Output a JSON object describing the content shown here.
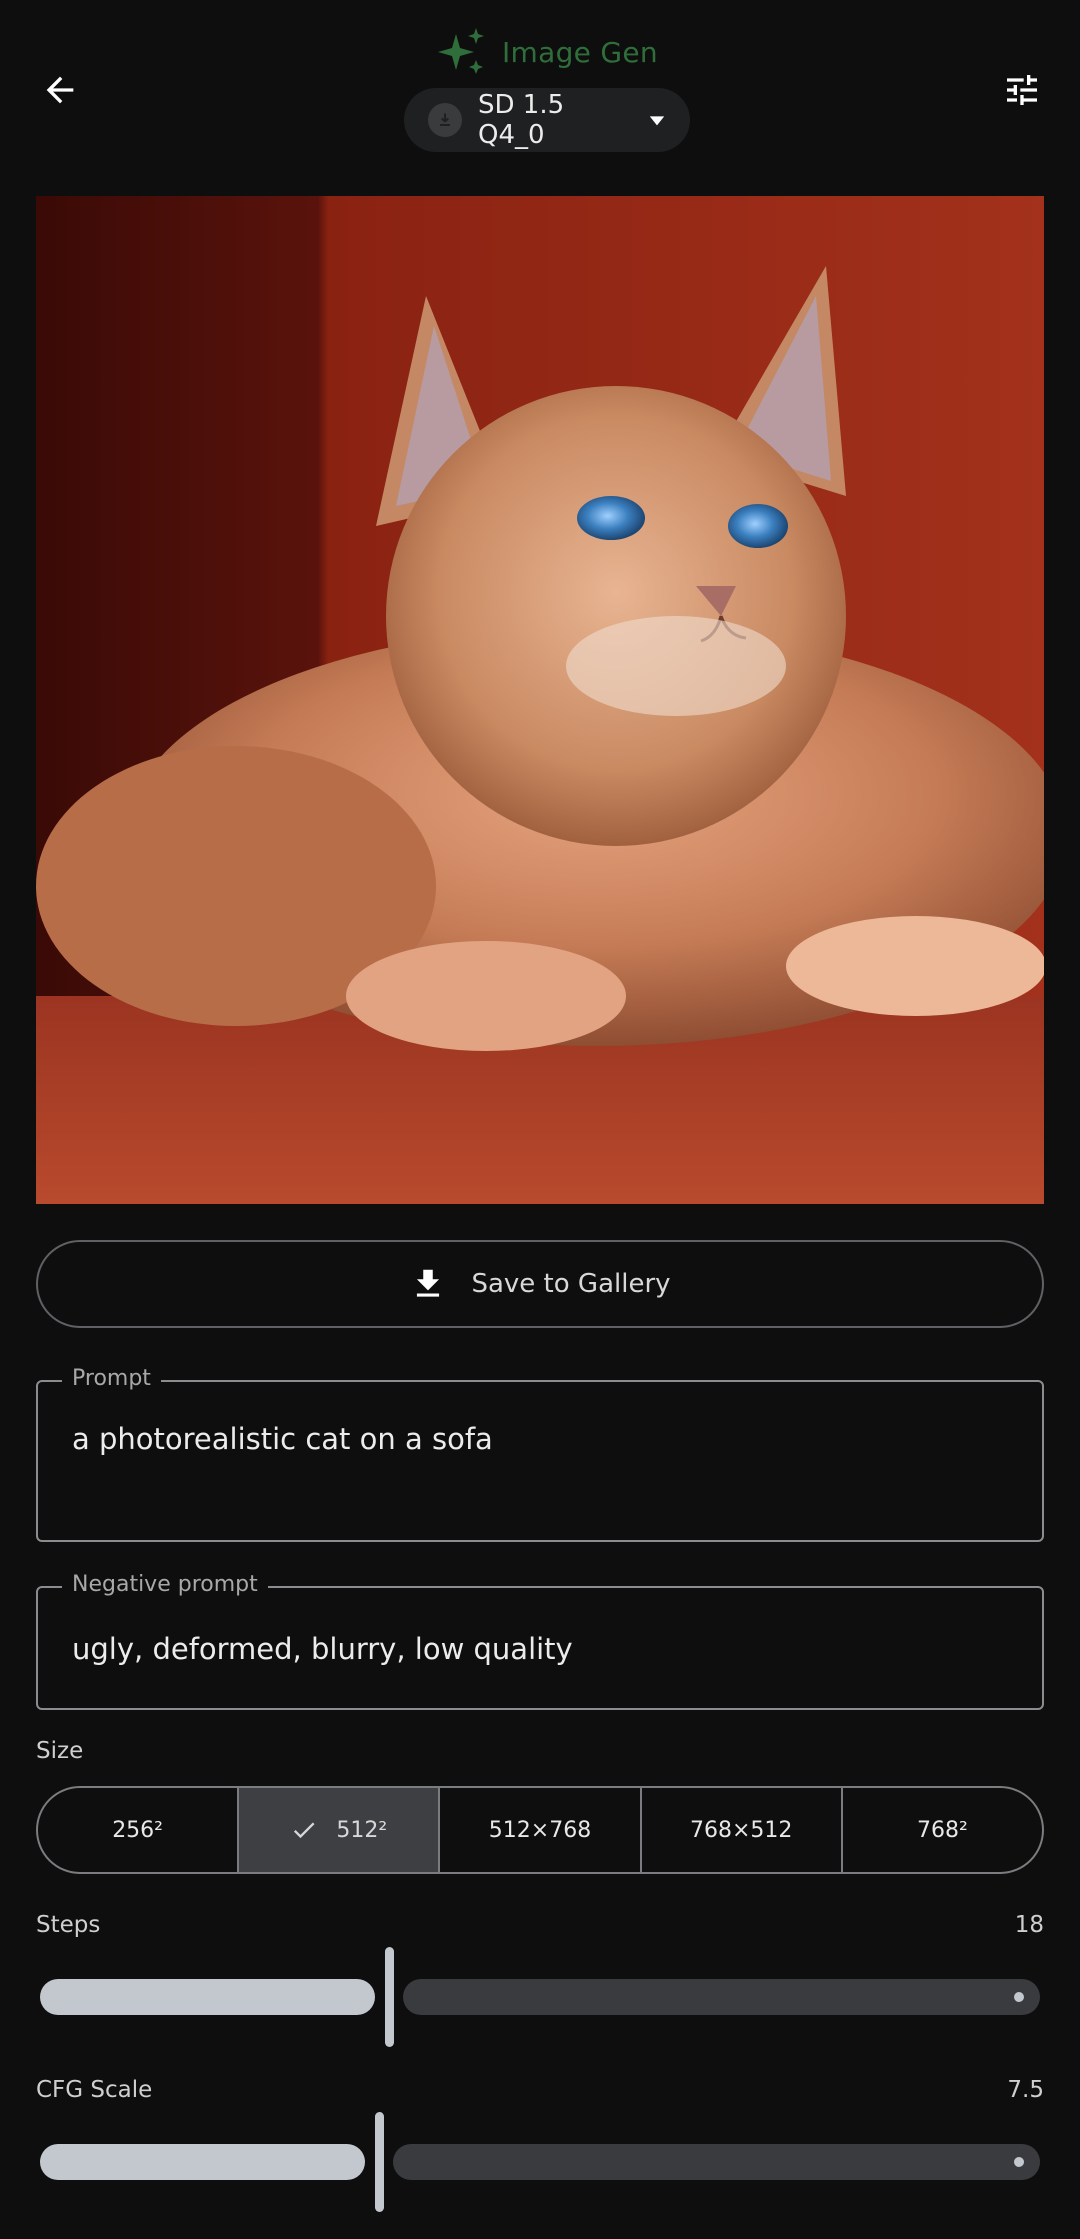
{
  "header": {
    "title": "Image Gen",
    "model_label": "SD 1.5 Q4_0",
    "icons": {
      "back": "arrow-left-icon",
      "sparkles": "sparkles-icon",
      "settings": "tune-sliders-icon",
      "model": "download-circle-icon",
      "dropdown": "caret-down-icon"
    }
  },
  "image": {
    "subject": "generated image"
  },
  "actions": {
    "save_label": "Save to Gallery"
  },
  "prompt": {
    "label": "Prompt",
    "value": "a photorealistic cat on a sofa"
  },
  "negative_prompt": {
    "label": "Negative prompt",
    "value": "ugly, deformed, blurry, low quality"
  },
  "size": {
    "label": "Size",
    "options": [
      "256²",
      "512²",
      "512×768",
      "768×512",
      "768²"
    ],
    "selected": "512²"
  },
  "steps": {
    "label": "Steps",
    "value": "18",
    "fraction": 0.35
  },
  "cfg": {
    "label": "CFG Scale",
    "value": "7.5",
    "fraction": 0.34
  },
  "colors": {
    "accent_green": "#2f6e3a",
    "background": "#0e0e0e",
    "slider_active": "#c3c8cf",
    "slider_inactive": "#393b3e"
  }
}
